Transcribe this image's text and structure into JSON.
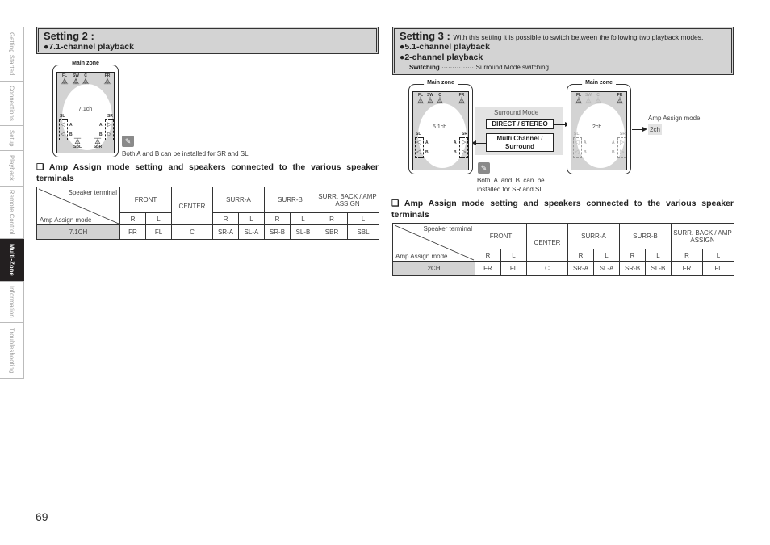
{
  "sidenav": {
    "tabs": [
      {
        "label": "Getting Started",
        "active": false
      },
      {
        "label": "Connections",
        "active": false
      },
      {
        "label": "Setup",
        "active": false
      },
      {
        "label": "Playback",
        "active": false
      },
      {
        "label": "Remote Control",
        "active": false
      },
      {
        "label": "Multi-Zone",
        "active": true
      },
      {
        "label": "Information",
        "active": false
      },
      {
        "label": "Troubleshooting",
        "active": false
      }
    ]
  },
  "page_number": "69",
  "setting2": {
    "title": "Setting 2 :",
    "bullet_symbol": "●",
    "bullet": "7.1-channel playback",
    "diagram": {
      "zone_label": "Main zone",
      "channel_label": "7.1ch",
      "front_speakers": [
        "FL",
        "SW",
        "C",
        "FR"
      ],
      "left_group": "SL",
      "right_group": "SR",
      "sub_a": "A",
      "sub_b": "B",
      "back_speakers": [
        "SBL",
        "SBR"
      ]
    },
    "memo_icon": "pencil-icon",
    "note": "Both A and B can be installed for SR and SL.",
    "section_heading": "❑ Amp Assign mode setting and speakers connected to the various speaker terminals",
    "table": {
      "corner_top": "Speaker terminal",
      "corner_bottom": "Amp Assign mode",
      "groups": [
        "FRONT",
        "CENTER",
        "SURR-A",
        "SURR-B",
        "SURR. BACK / AMP ASSIGN"
      ],
      "subheaders": [
        "R",
        "L",
        "R",
        "L",
        "R",
        "L",
        "R",
        "L"
      ],
      "rows": [
        {
          "mode": "7.1CH",
          "cells": [
            "FR",
            "FL",
            "C",
            "SR-A",
            "SL-A",
            "SR-B",
            "SL-B",
            "SBR",
            "SBL"
          ]
        }
      ]
    }
  },
  "setting3": {
    "title": "Setting 3 :",
    "description": "With this setting it is possible to switch between the following two playback modes.",
    "bullet_symbol": "●",
    "bullets": [
      "5.1-channel playback",
      "2-channel playback"
    ],
    "switching_label": "Switching",
    "switching_dots": "················",
    "switching_value": "Surround Mode switching",
    "diagram_left": {
      "zone_label": "Main zone",
      "channel_label": "5.1ch",
      "front_speakers": [
        "FL",
        "SW",
        "C",
        "FR"
      ],
      "left_group": "SL",
      "right_group": "SR",
      "sub_a": "A",
      "sub_b": "B"
    },
    "surround_mode": {
      "label": "Surround Mode",
      "button_direct": "DIRECT / STEREO",
      "button_multi_line1": "Multi Channel /",
      "button_multi_line2": "Surround"
    },
    "diagram_right": {
      "zone_label": "Main zone",
      "channel_label": "2ch",
      "front_speakers": [
        "FL",
        "SW",
        "C",
        "FR"
      ],
      "left_group": "SL",
      "right_group": "SR",
      "sub_a": "A",
      "sub_b": "B"
    },
    "amp_assign_label": "Amp Assign mode:",
    "amp_assign_value": "2ch",
    "memo_icon": "pencil-icon",
    "note_line1": "Both  A  and  B  can  be",
    "note_line2": "installed for SR and SL.",
    "section_heading": "❑ Amp Assign mode setting and speakers connected to the various speaker terminals",
    "table": {
      "corner_top": "Speaker terminal",
      "corner_bottom": "Amp Assign mode",
      "groups": [
        "FRONT",
        "CENTER",
        "SURR-A",
        "SURR-B",
        "SURR. BACK / AMP ASSIGN"
      ],
      "subheaders": [
        "R",
        "L",
        "R",
        "L",
        "R",
        "L",
        "R",
        "L"
      ],
      "rows": [
        {
          "mode": "2CH",
          "cells": [
            "FR",
            "FL",
            "C",
            "SR-A",
            "SL-A",
            "SR-B",
            "SL-B",
            "FR",
            "FL"
          ]
        }
      ]
    }
  }
}
